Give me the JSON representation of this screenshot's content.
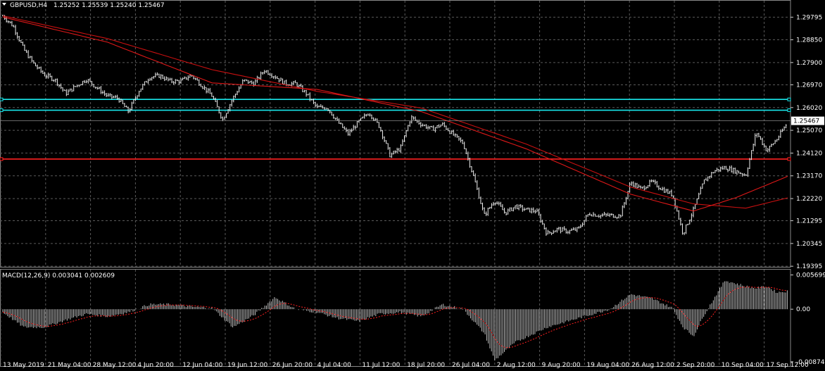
{
  "main_pane": {
    "symbol_label": "GBPUSD,H4",
    "ohlc": [
      "1.25252",
      "1.25539",
      "1.25240",
      "1.25467"
    ],
    "price_labels": [
      "1.29795",
      "1.28850",
      "1.27900",
      "1.26970",
      "1.26020",
      "1.25070",
      "1.24120",
      "1.23170",
      "1.22220",
      "1.21295",
      "1.20345",
      "1.19395"
    ],
    "current_price": "1.25467",
    "hlines": [
      {
        "price": 1.2636,
        "color": "#19e6ea",
        "name": "resistance-line-upper"
      },
      {
        "price": 1.2591,
        "color": "#19e6ea",
        "name": "resistance-line-lower"
      },
      {
        "price": 1.2387,
        "color": "#ff2020",
        "name": "support-line"
      }
    ]
  },
  "macd_pane": {
    "label": "MACD(12,26,9) 0.003041 0.002609",
    "scale_labels": [
      "0.005699",
      "0.00",
      "-0.008748"
    ]
  },
  "time_axis": [
    "13 May 2019",
    "21 May 04:00",
    "28 May 12:00",
    "4 Jun 20:00",
    "12 Jun 04:00",
    "19 Jun 12:00",
    "26 Jun 20:00",
    "4 Jul 04:00",
    "11 Jul 12:00",
    "18 Jul 20:00",
    "26 Jul 04:00",
    "2 Aug 12:00",
    "9 Aug 20:00",
    "19 Aug 04:00",
    "26 Aug 12:00",
    "2 Sep 20:00",
    "10 Sep 04:00",
    "17 Sep 12:00"
  ],
  "colors": {
    "background": "#000000",
    "grid": "#5a5a5a",
    "candle": "#f0f0f0",
    "ma_fast": "#e01818",
    "ma_slow": "#c81010",
    "macd_hist": "#c0c0c0",
    "macd_signal": "#ff2020"
  },
  "chart_data": {
    "type": "line",
    "title": "GBPUSD,H4",
    "price_path": [
      [
        0,
        1.2985
      ],
      [
        1,
        1.2942
      ],
      [
        2,
        1.2845
      ],
      [
        3,
        1.2782
      ],
      [
        4,
        1.2738
      ],
      [
        5,
        1.2718
      ],
      [
        6,
        1.266
      ],
      [
        7,
        1.2692
      ],
      [
        8,
        1.272
      ],
      [
        9,
        1.2684
      ],
      [
        10,
        1.265
      ],
      [
        11,
        1.2641
      ],
      [
        12,
        1.2585
      ],
      [
        13,
        1.2672
      ],
      [
        14,
        1.2729
      ],
      [
        15,
        1.2735
      ],
      [
        16,
        1.2712
      ],
      [
        17,
        1.2712
      ],
      [
        18,
        1.2738
      ],
      [
        19,
        1.2695
      ],
      [
        20,
        1.265
      ],
      [
        21,
        1.2552
      ],
      [
        22,
        1.2642
      ],
      [
        23,
        1.2715
      ],
      [
        24,
        1.2702
      ],
      [
        25,
        1.2758
      ],
      [
        26,
        1.2732
      ],
      [
        27,
        1.2702
      ],
      [
        28,
        1.2702
      ],
      [
        29,
        1.266
      ],
      [
        30,
        1.2602
      ],
      [
        31,
        1.2602
      ],
      [
        32,
        1.2542
      ],
      [
        33,
        1.2492
      ],
      [
        34,
        1.2542
      ],
      [
        35,
        1.2582
      ],
      [
        36,
        1.2522
      ],
      [
        37,
        1.2402
      ],
      [
        38,
        1.2432
      ],
      [
        39,
        1.2562
      ],
      [
        40,
        1.2532
      ],
      [
        41,
        1.2512
      ],
      [
        42,
        1.2532
      ],
      [
        43,
        1.249
      ],
      [
        44,
        1.2452
      ],
      [
        45,
        1.2312
      ],
      [
        46,
        1.2152
      ],
      [
        47,
        1.2215
      ],
      [
        48,
        1.2162
      ],
      [
        49,
        1.219
      ],
      [
        50,
        1.2175
      ],
      [
        51,
        1.217
      ],
      [
        52,
        1.2075
      ],
      [
        53,
        1.2095
      ],
      [
        54,
        1.2085
      ],
      [
        55,
        1.2095
      ],
      [
        56,
        1.216
      ],
      [
        57,
        1.2152
      ],
      [
        58,
        1.2152
      ],
      [
        59,
        1.215
      ],
      [
        60,
        1.229
      ],
      [
        61,
        1.2262
      ],
      [
        62,
        1.2292
      ],
      [
        63,
        1.2262
      ],
      [
        64,
        1.2238
      ],
      [
        65,
        1.2075
      ],
      [
        66,
        1.2175
      ],
      [
        67,
        1.2295
      ],
      [
        68,
        1.2338
      ],
      [
        69,
        1.2352
      ],
      [
        70,
        1.2337
      ],
      [
        71,
        1.232
      ],
      [
        72,
        1.25
      ],
      [
        73,
        1.2422
      ],
      [
        74,
        1.2472
      ],
      [
        75,
        1.254
      ]
    ],
    "ma_fast": [
      [
        0,
        1.298
      ],
      [
        10,
        1.2875
      ],
      [
        20,
        1.2705
      ],
      [
        30,
        1.2678
      ],
      [
        40,
        1.2585
      ],
      [
        50,
        1.243
      ],
      [
        60,
        1.224
      ],
      [
        66,
        1.217
      ],
      [
        70,
        1.2225
      ],
      [
        75,
        1.2315
      ]
    ],
    "ma_slow": [
      [
        0,
        1.2985
      ],
      [
        10,
        1.289
      ],
      [
        20,
        1.276
      ],
      [
        30,
        1.267
      ],
      [
        40,
        1.26
      ],
      [
        50,
        1.245
      ],
      [
        60,
        1.227
      ],
      [
        66,
        1.22
      ],
      [
        71,
        1.2182
      ],
      [
        75,
        1.2225
      ]
    ],
    "macd_hist": [
      [
        0,
        -0.0005
      ],
      [
        2,
        -0.003
      ],
      [
        4,
        -0.003
      ],
      [
        6,
        -0.0018
      ],
      [
        8,
        -0.0008
      ],
      [
        10,
        -0.0012
      ],
      [
        12,
        -0.0005
      ],
      [
        14,
        0.0008
      ],
      [
        16,
        0.0008
      ],
      [
        18,
        0.0004
      ],
      [
        20,
        0.0002
      ],
      [
        22,
        -0.003
      ],
      [
        24,
        -0.001
      ],
      [
        26,
        0.002
      ],
      [
        28,
        0.0
      ],
      [
        30,
        -0.0005
      ],
      [
        32,
        -0.0015
      ],
      [
        34,
        -0.002
      ],
      [
        36,
        -0.0008
      ],
      [
        38,
        -0.0005
      ],
      [
        40,
        -0.0012
      ],
      [
        42,
        0.0008
      ],
      [
        44,
        0.0
      ],
      [
        46,
        -0.004
      ],
      [
        47,
        -0.0085
      ],
      [
        49,
        -0.0055
      ],
      [
        52,
        -0.003
      ],
      [
        54,
        -0.002
      ],
      [
        56,
        -0.001
      ],
      [
        58,
        0.0
      ],
      [
        60,
        0.0025
      ],
      [
        62,
        0.0018
      ],
      [
        64,
        0.0002
      ],
      [
        65,
        -0.003
      ],
      [
        66,
        -0.0045
      ],
      [
        67,
        -0.001
      ],
      [
        69,
        0.0048
      ],
      [
        71,
        0.0038
      ],
      [
        72,
        0.0035
      ],
      [
        73,
        0.0038
      ],
      [
        74,
        0.0028
      ],
      [
        75,
        0.003
      ]
    ],
    "y_range": [
      1.194,
      1.301
    ],
    "macd_range": [
      -0.009,
      0.006
    ],
    "grid": true
  }
}
